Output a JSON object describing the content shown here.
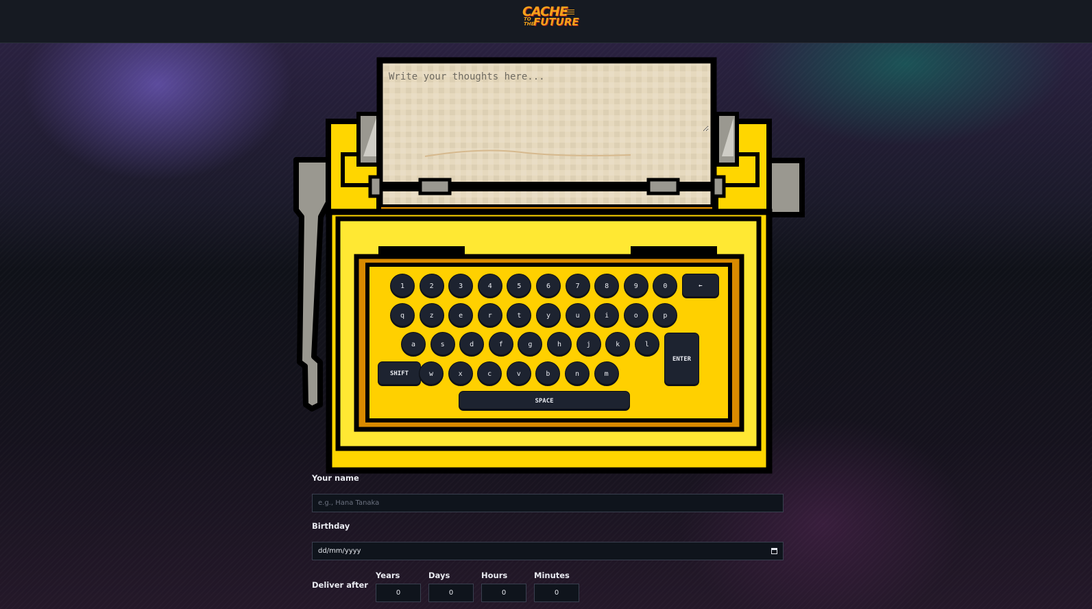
{
  "header": {
    "logo": {
      "line1": "CACHE",
      "to": "TO",
      "the": "THE",
      "line2": "FUTURE"
    }
  },
  "typewriter": {
    "paper_placeholder": "Write your thoughts here...",
    "colors": {
      "body": "#ffd600",
      "outline": "#000000",
      "paper": "#e8dcc3",
      "arm": "#9a9890"
    },
    "keys": {
      "row1": [
        "1",
        "2",
        "3",
        "4",
        "5",
        "6",
        "7",
        "8",
        "9",
        "0"
      ],
      "backspace": "←",
      "row2": [
        "q",
        "z",
        "e",
        "r",
        "t",
        "y",
        "u",
        "i",
        "o",
        "p"
      ],
      "row3": [
        "a",
        "s",
        "d",
        "f",
        "g",
        "h",
        "j",
        "k",
        "l"
      ],
      "enter": "ENTER",
      "shift": "SHIFT",
      "row4": [
        "w",
        "x",
        "c",
        "v",
        "b",
        "n",
        "m"
      ],
      "space": "SPACE"
    }
  },
  "form": {
    "name_label": "Your name",
    "name_placeholder": "e.g., Hana Tanaka",
    "birthday_label": "Birthday",
    "birthday_value": "dd/mm/yyyy",
    "deliver_label": "Deliver after",
    "fields": [
      {
        "label": "Years",
        "value": "0"
      },
      {
        "label": "Days",
        "value": "0"
      },
      {
        "label": "Hours",
        "value": "0"
      },
      {
        "label": "Minutes",
        "value": "0"
      }
    ]
  }
}
